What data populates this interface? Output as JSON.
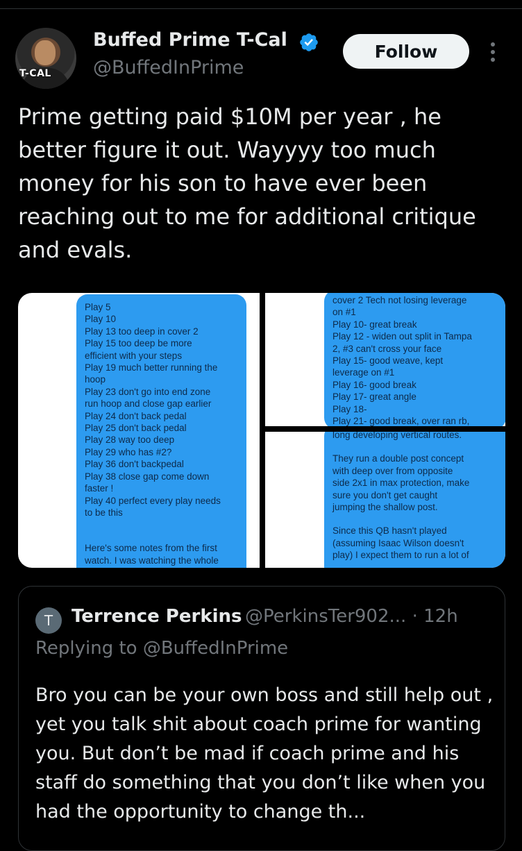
{
  "author": {
    "name": "Buffed Prime T-Cal",
    "handle": "@BuffedInPrime",
    "avatar_tag": "T-CAL",
    "verified_color": "#1d9bf0"
  },
  "actions": {
    "follow_label": "Follow"
  },
  "tweet": {
    "text": "Prime getting paid $10M per year , he better figure it out. Wayyyy too much money for his son to have ever been reaching out to me for additional critique and evals."
  },
  "media": {
    "panel1_lines": [
      "Play 5",
      "Play 10",
      "Play 13 too deep in cover 2",
      "Play 15 too deep be more",
      "efficient with your steps",
      "Play 19 much better running the",
      "hoop",
      "Play 23 don't go into end zone",
      "run hoop and close gap earlier",
      "Play 24 don't back pedal",
      "Play 25 don't back pedal",
      "Play 28 way too deep",
      "Play 29 who has #2?",
      "Play 36 don't backpedal",
      "Play 38 close gap come down",
      "faster !",
      "Play 40 perfect every play needs",
      "to be this",
      "",
      "",
      "Here's some notes from the first",
      "watch. I was watching the whole"
    ],
    "panel2_lines": [
      "cover 2 Tech not losing leverage",
      "on #1",
      "Play 10- great break",
      "Play 12 - widen out split in Tampa",
      "2, #3 can't cross your face",
      "Play 15- good weave, kept",
      "leverage on #1",
      "Play 16- good break",
      "Play 17- great angle",
      "Play 18-",
      "Play 21- good break, over ran rb,"
    ],
    "panel3_lines": [
      "long developing vertical routes.",
      "",
      "They run a double post concept",
      "with deep over from opposite",
      "side 2x1 in max protection, make",
      "sure you don't get caught",
      "jumping the shallow post.",
      "",
      "Since this QB hasn't played",
      "(assuming Isaac Wilson doesn't",
      "play) I expect them to run a lot of"
    ],
    "bubble_color": "#2d9bf0"
  },
  "quote": {
    "avatar_letter": "T",
    "name": "Terrence Perkins",
    "handle_time": "@PerkinsTer902... · 12h",
    "replying": "Replying to @BuffedInPrime",
    "text": "Bro you can be your own boss and still help out , yet you talk shit about coach prime for wanting you. But don’t be mad if coach prime and his staff do something that you don’t like when you had the opportunity to change th..."
  }
}
